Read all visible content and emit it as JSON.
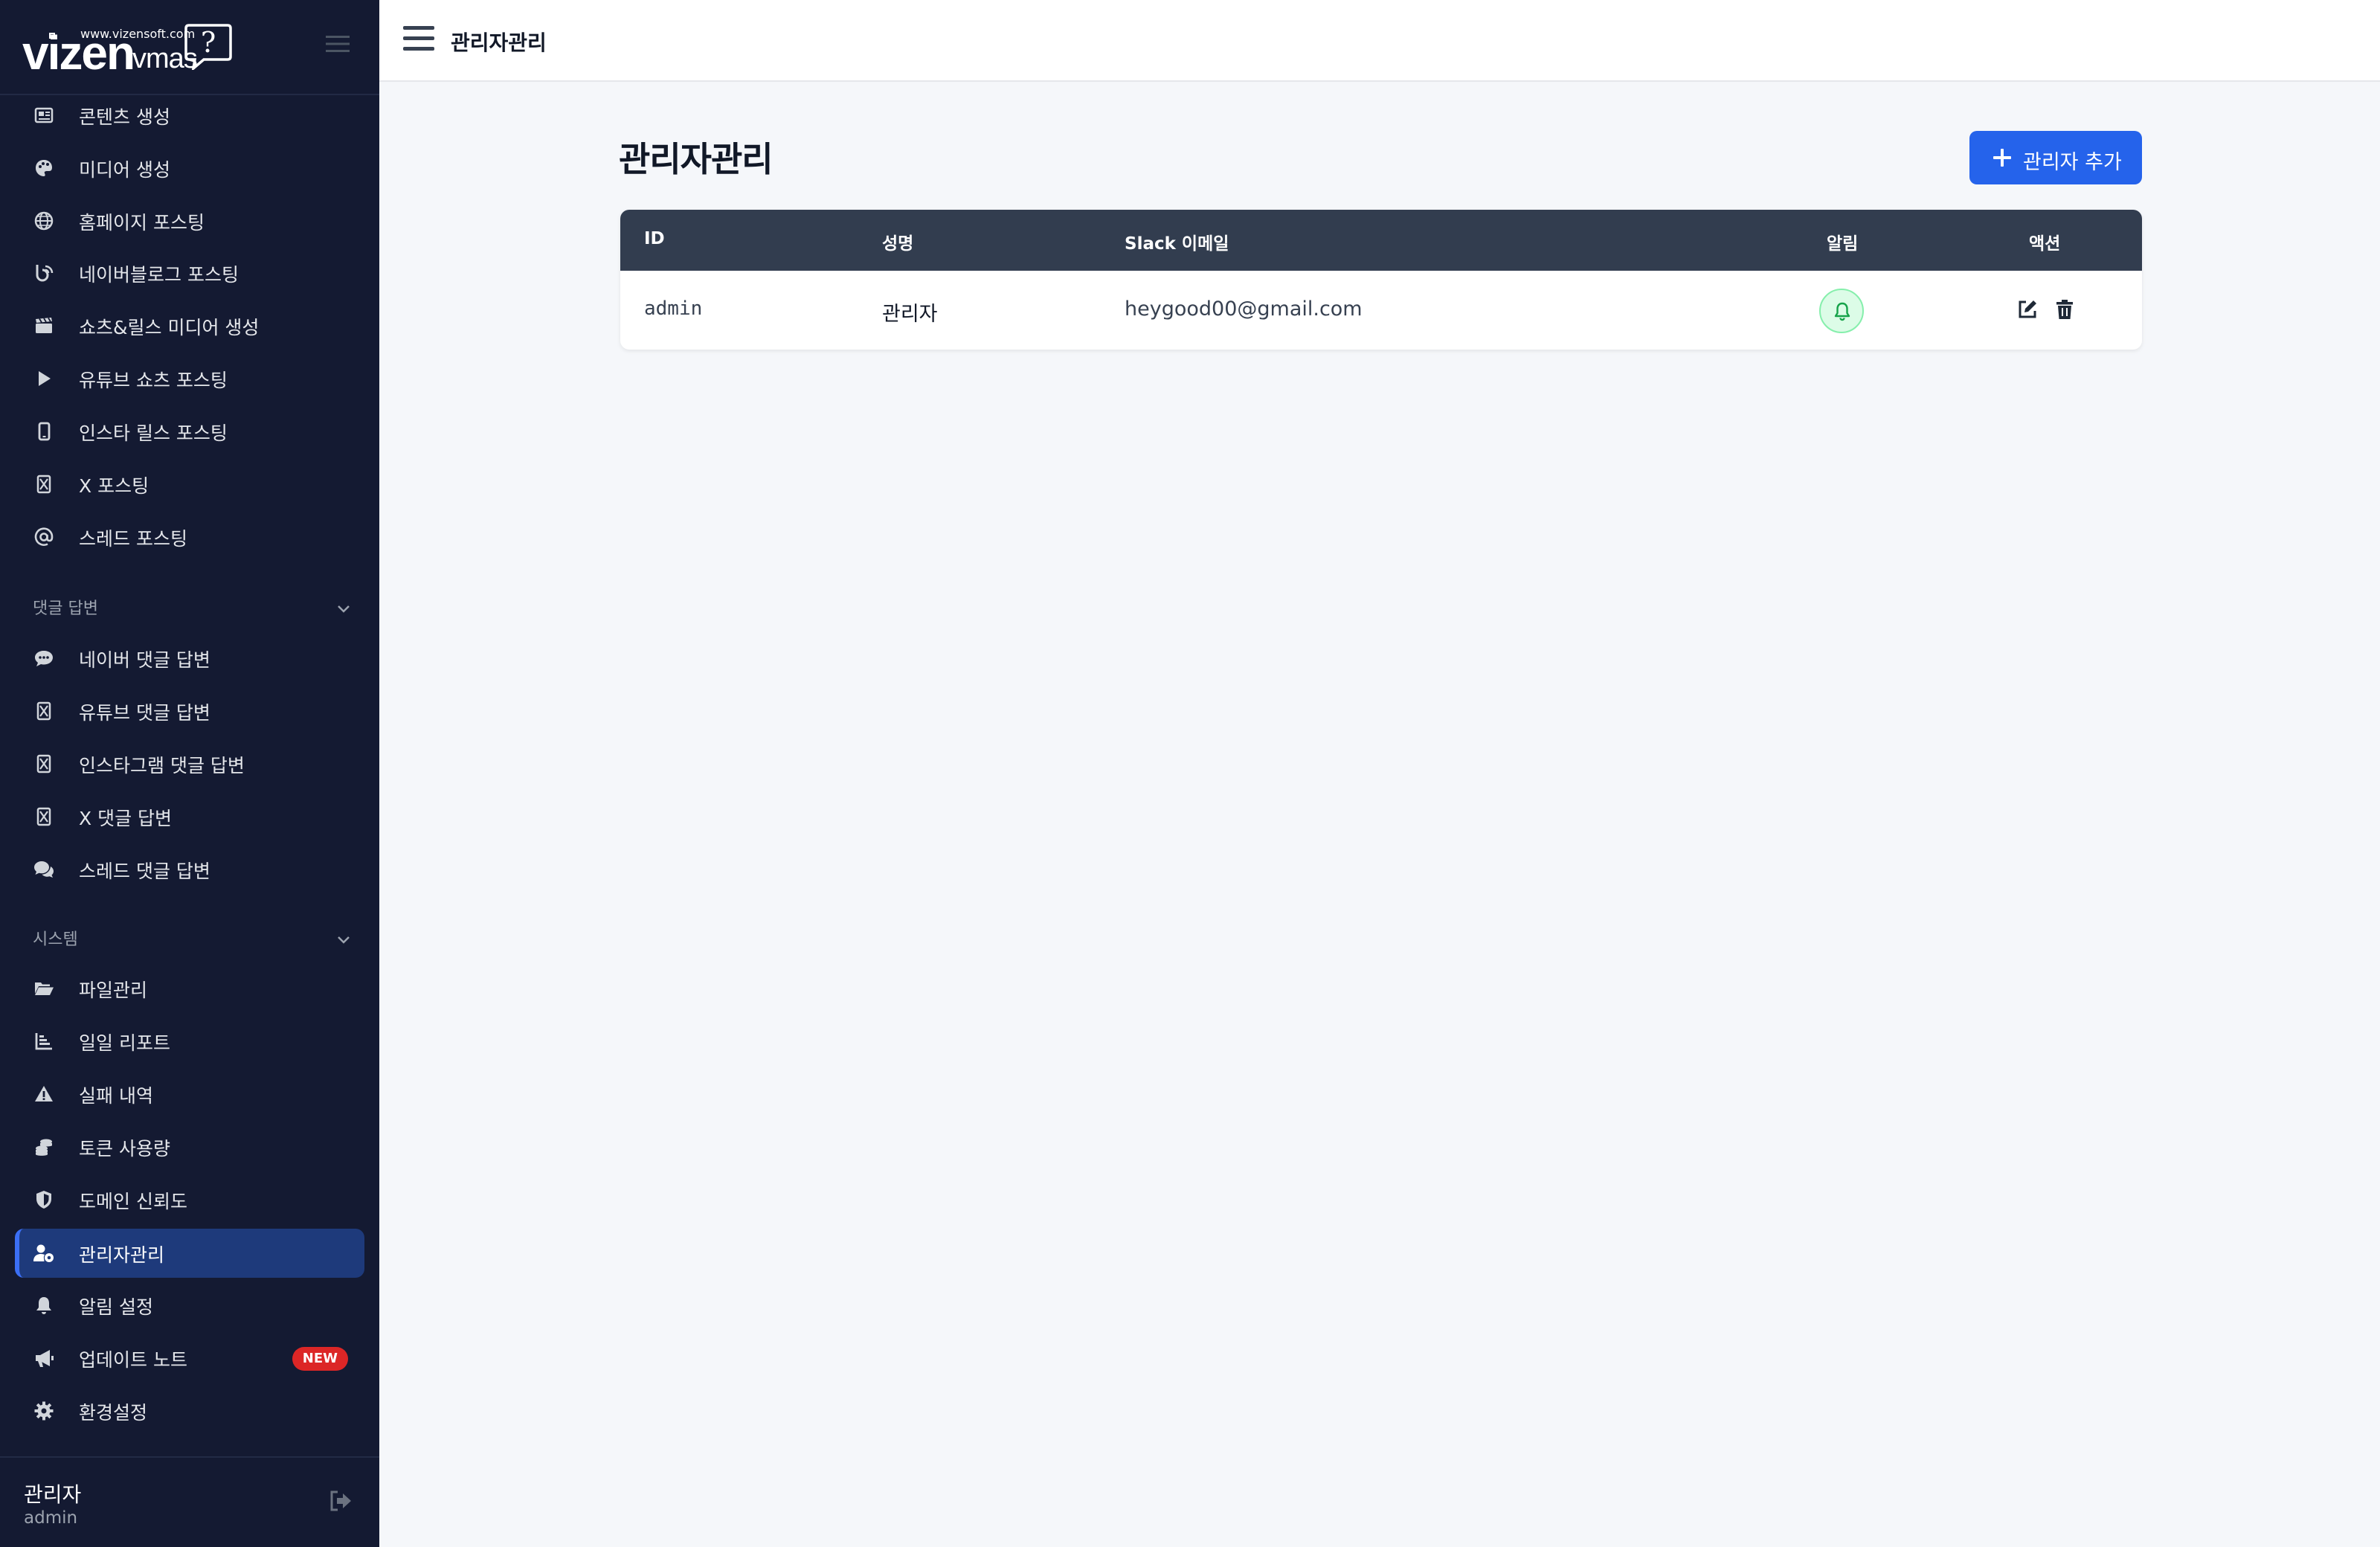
{
  "brand": {
    "url": "www.vizensoft.com",
    "name": "vizen",
    "product": "vmas"
  },
  "nav_top": [
    {
      "label": "콘텐츠 생성",
      "icon": "newspaper-icon"
    },
    {
      "label": "미디어 생성",
      "icon": "palette-icon"
    },
    {
      "label": "홈페이지 포스팅",
      "icon": "globe-icon"
    },
    {
      "label": "네이버블로그 포스팅",
      "icon": "blog-icon"
    },
    {
      "label": "쇼츠&릴스 미디어 생성",
      "icon": "clapperboard-icon"
    },
    {
      "label": "유튜브 쇼츠 포스팅",
      "icon": "play-icon"
    },
    {
      "label": "인스타 릴스 포스팅",
      "icon": "mobile-icon"
    },
    {
      "label": "X 포스팅",
      "icon": "x-logo-icon"
    },
    {
      "label": "스레드 포스팅",
      "icon": "at-icon"
    }
  ],
  "section_comments": {
    "title": "댓글 답변",
    "items": [
      {
        "label": "네이버 댓글 답변",
        "icon": "comment-dots-icon"
      },
      {
        "label": "유튜브 댓글 답변",
        "icon": "x-logo-icon"
      },
      {
        "label": "인스타그램 댓글 답변",
        "icon": "x-logo-icon"
      },
      {
        "label": "X 댓글 답변",
        "icon": "x-logo-icon"
      },
      {
        "label": "스레드 댓글 답변",
        "icon": "comments-icon"
      }
    ]
  },
  "section_system": {
    "title": "시스템",
    "items": [
      {
        "label": "파일관리",
        "icon": "folder-open-icon"
      },
      {
        "label": "일일 리포트",
        "icon": "bar-chart-icon"
      },
      {
        "label": "실패 내역",
        "icon": "warning-icon"
      },
      {
        "label": "토큰 사용량",
        "icon": "coins-icon"
      },
      {
        "label": "도메인 신뢰도",
        "icon": "shield-icon"
      },
      {
        "label": "관리자관리",
        "icon": "user-gear-icon",
        "active": true
      },
      {
        "label": "알림 설정",
        "icon": "bell-icon"
      },
      {
        "label": "업데이트 노트",
        "icon": "megaphone-icon",
        "badge": "NEW"
      },
      {
        "label": "환경설정",
        "icon": "gear-icon"
      }
    ]
  },
  "user": {
    "name": "관리자",
    "id": "admin"
  },
  "topbar": {
    "title": "관리자관리"
  },
  "page": {
    "title": "관리자관리",
    "add_button": "관리자 추가"
  },
  "table": {
    "headers": {
      "id": "ID",
      "name": "성명",
      "email": "Slack 이메일",
      "alert": "알림",
      "action": "액션"
    },
    "rows": [
      {
        "id": "admin",
        "name": "관리자",
        "email": "heygood00@gmail.com",
        "alert_enabled": true
      }
    ]
  },
  "colors": {
    "sidebar_bg": "#141a32",
    "active_bg": "#1e3a7b",
    "accent": "#2563eb",
    "table_header": "#323d4f",
    "badge": "#dc2626",
    "alert_green": "#16a34a"
  }
}
